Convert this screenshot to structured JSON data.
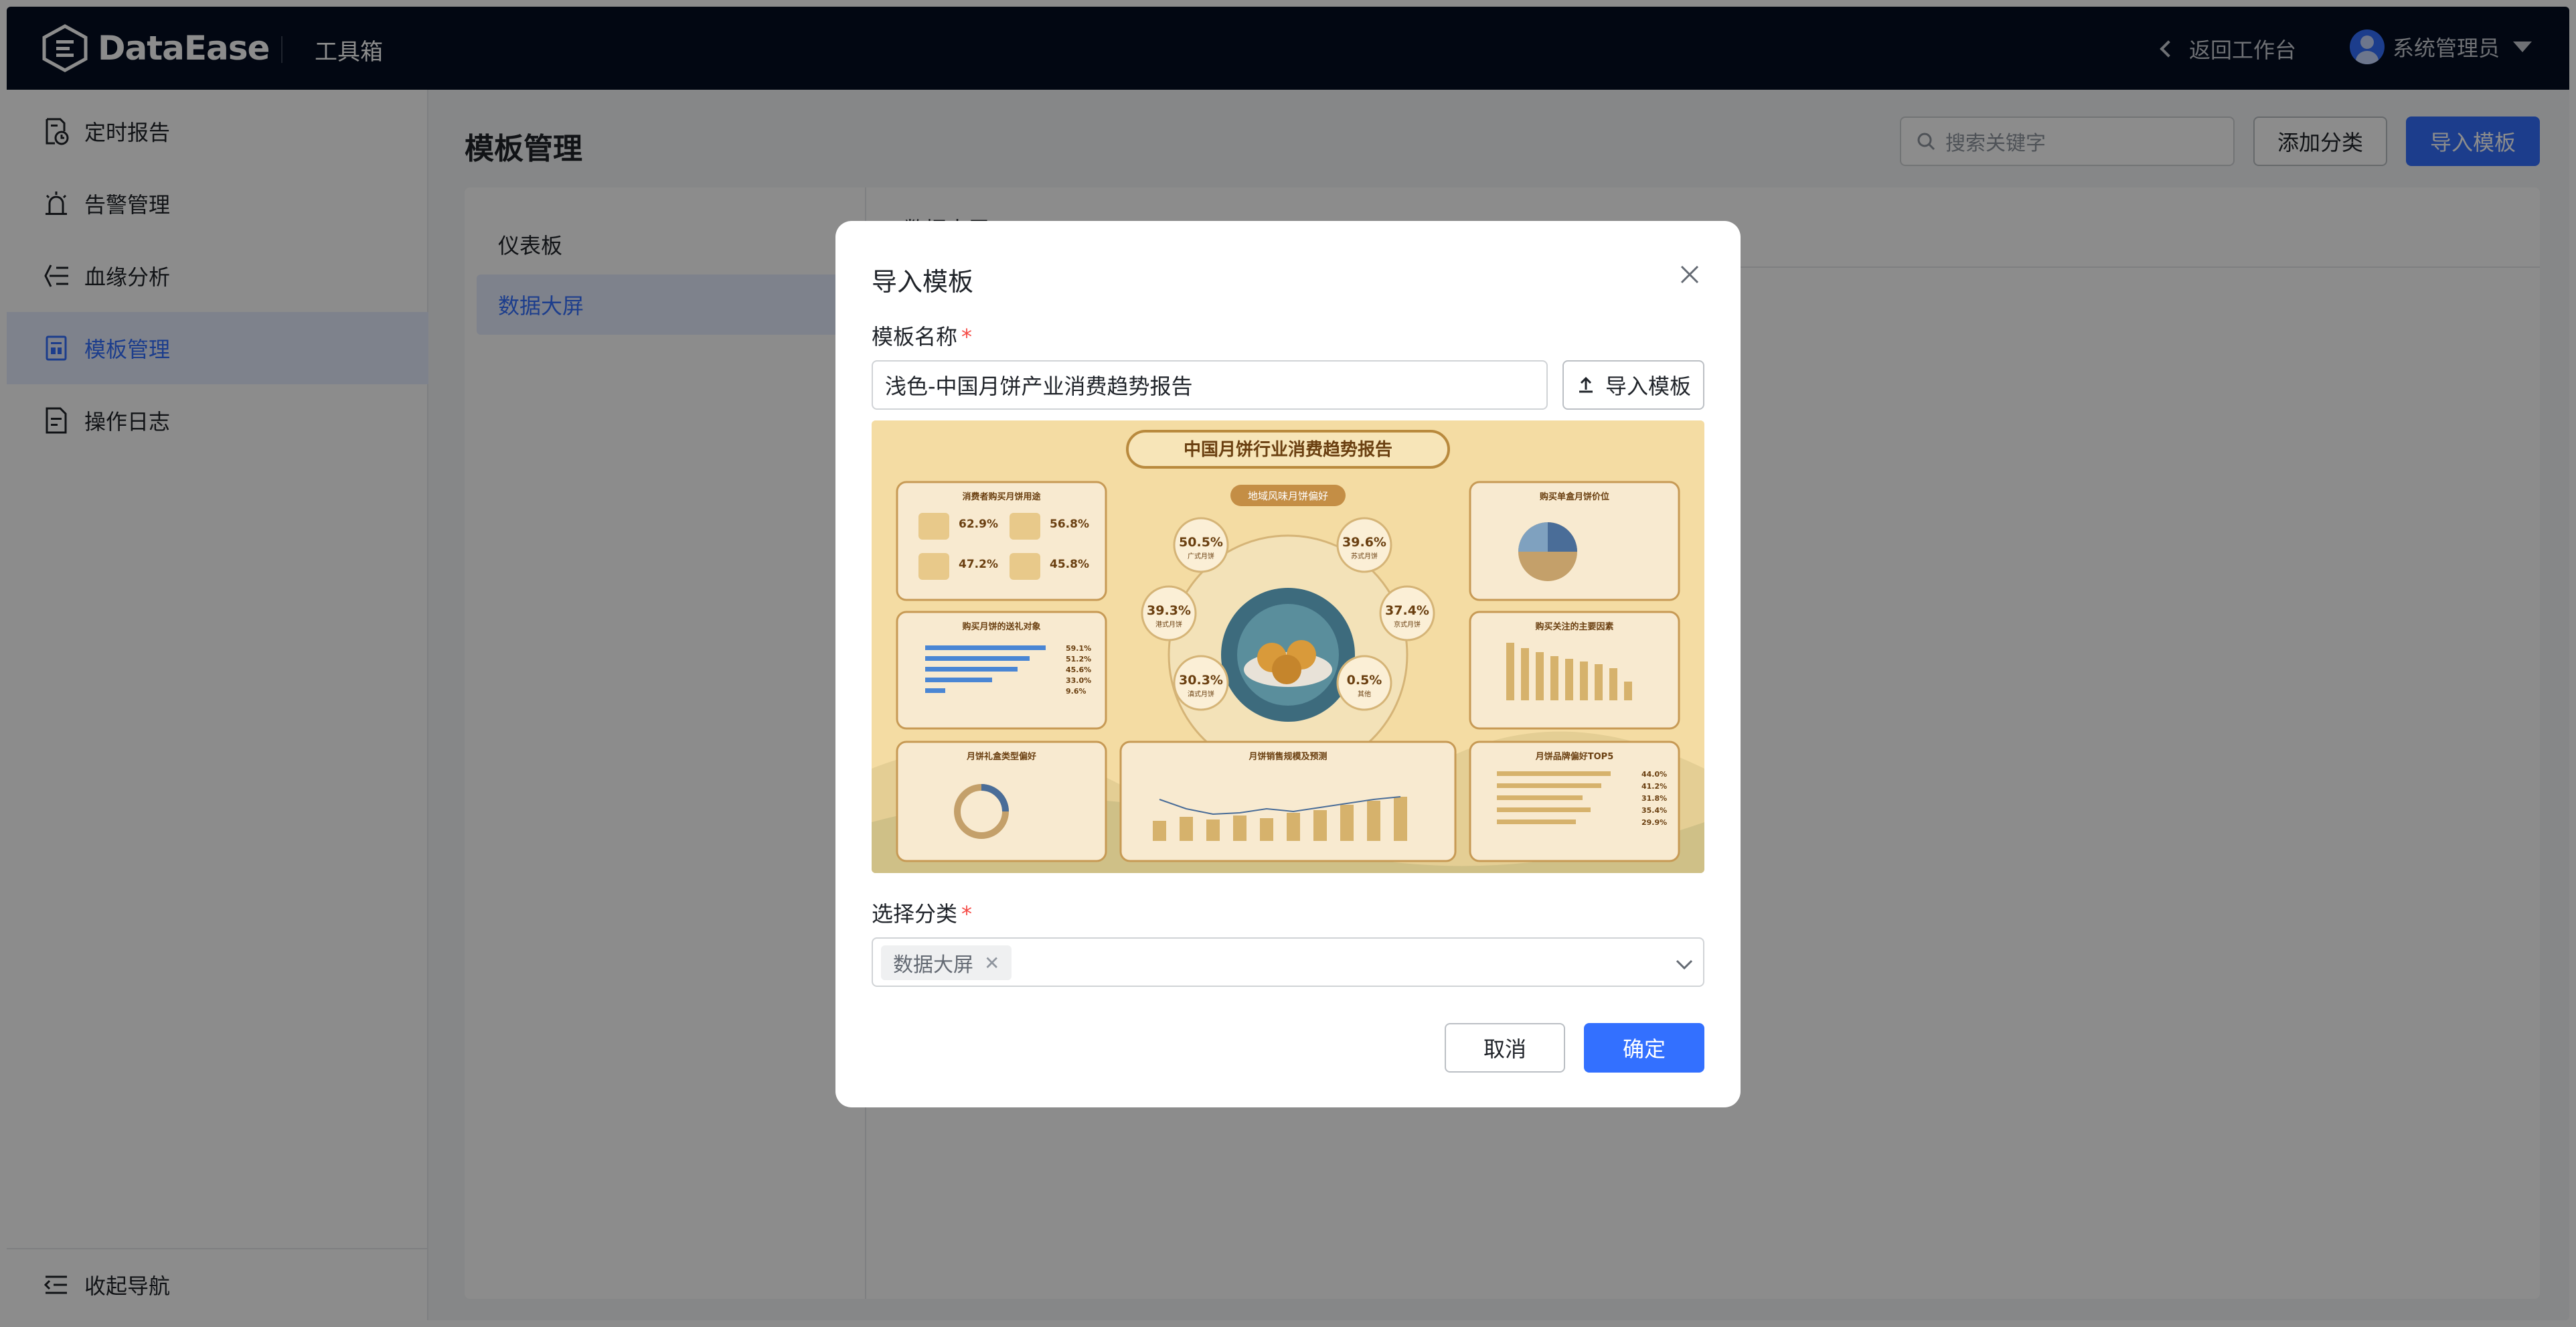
{
  "app": {
    "logo_text": "DataEase",
    "section": "工具箱"
  },
  "header": {
    "back_label": "返回工作台",
    "user_name": "系统管理员"
  },
  "sidebar": {
    "items": [
      {
        "label": "定时报告",
        "icon": "scheduled-report-icon"
      },
      {
        "label": "告警管理",
        "icon": "alarm-icon"
      },
      {
        "label": "血缘分析",
        "icon": "lineage-icon"
      },
      {
        "label": "模板管理",
        "icon": "template-icon",
        "active": true
      },
      {
        "label": "操作日志",
        "icon": "log-icon"
      }
    ],
    "collapse_label": "收起导航"
  },
  "main": {
    "title": "模板管理",
    "search_placeholder": "搜索关键字",
    "add_category_label": "添加分类",
    "import_label": "导入模板",
    "categories": [
      {
        "label": "仪表板"
      },
      {
        "label": "数据大屏",
        "active": true
      }
    ]
  },
  "dialog": {
    "title": "导入模板",
    "name_label": "模板名称",
    "name_value": "浅色-中国月饼产业消费趋势报告",
    "upload_label": "导入模板",
    "category_label": "选择分类",
    "selected_category": "数据大屏",
    "cancel_label": "取消",
    "confirm_label": "确定",
    "preview": {
      "title": "中国月饼行业消费趋势报告",
      "center_title": "地域风味月饼偏好",
      "panels": [
        "消费者购买月饼用途",
        "购买单盒月饼价位",
        "购买月饼的送礼对象",
        "购买关注的主要因素",
        "月饼礼盒类型偏好",
        "月饼销售规模及预测",
        "月饼品牌偏好TOP5"
      ],
      "usage_stats": [
        "62.9%",
        "56.8%",
        "47.2%",
        "45.8%"
      ],
      "region_stats": [
        {
          "value": "50.5%",
          "label": "广式月饼"
        },
        {
          "value": "39.6%",
          "label": "苏式月饼"
        },
        {
          "value": "39.3%",
          "label": "港式月饼"
        },
        {
          "value": "37.4%",
          "label": "京式月饼"
        },
        {
          "value": "30.3%",
          "label": "滇式月饼"
        },
        {
          "value": "0.5%",
          "label": "其他"
        }
      ],
      "gift_values": [
        "59.1%",
        "51.2%",
        "45.6%",
        "33.0%",
        "9.6%"
      ],
      "brand_values": [
        "44.0%",
        "41.2%",
        "31.8%",
        "35.4%",
        "29.9%"
      ]
    }
  },
  "colors": {
    "accent": "#3370ff",
    "topbar": "#050e21",
    "active_bg": "#e6edff"
  }
}
